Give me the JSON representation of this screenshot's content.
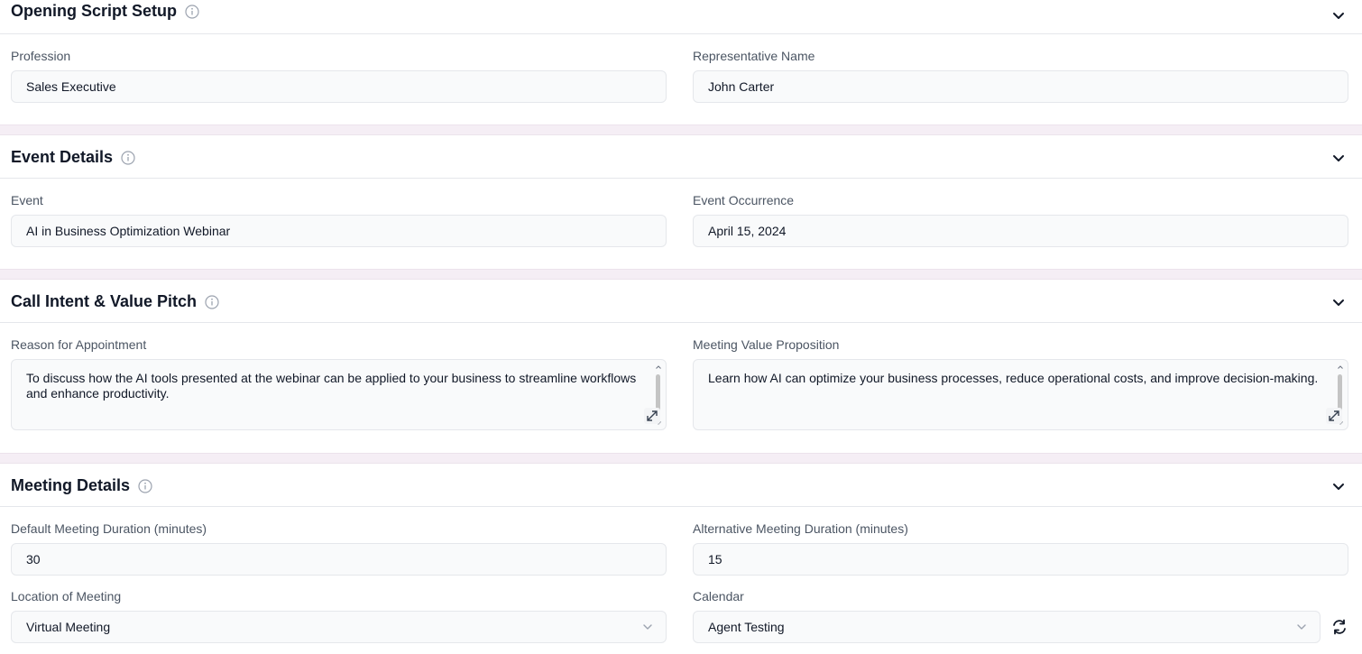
{
  "sections": {
    "opening": {
      "title": "Opening Script Setup",
      "profession_label": "Profession",
      "profession_value": "Sales Executive",
      "rep_label": "Representative Name",
      "rep_value": "John Carter"
    },
    "event": {
      "title": "Event Details",
      "event_label": "Event",
      "event_value": "AI in Business Optimization Webinar",
      "occurrence_label": "Event Occurrence",
      "occurrence_value": "April 15, 2024"
    },
    "intent": {
      "title": "Call Intent & Value Pitch",
      "reason_label": "Reason for Appointment",
      "reason_value": "To discuss how the AI tools presented at the webinar can be applied to your business to streamline workflows and enhance productivity.",
      "value_label": "Meeting Value Proposition",
      "value_value": "Learn how AI can optimize your business processes, reduce operational costs, and improve decision-making."
    },
    "meeting": {
      "title": "Meeting Details",
      "default_duration_label": "Default Meeting Duration (minutes)",
      "default_duration_value": "30",
      "alt_duration_label": "Alternative Meeting Duration (minutes)",
      "alt_duration_value": "15",
      "location_label": "Location of Meeting",
      "location_value": "Virtual Meeting",
      "calendar_label": "Calendar",
      "calendar_value": "Agent Testing"
    }
  },
  "icons": {
    "info": "info-icon",
    "chevron": "chevron-down-icon",
    "expand": "expand-icon",
    "refresh": "refresh-icon"
  },
  "colors": {
    "divider": "#f5eef5",
    "field_bg": "#f9fafb",
    "border": "#e5e7eb",
    "label": "#4b5563"
  }
}
